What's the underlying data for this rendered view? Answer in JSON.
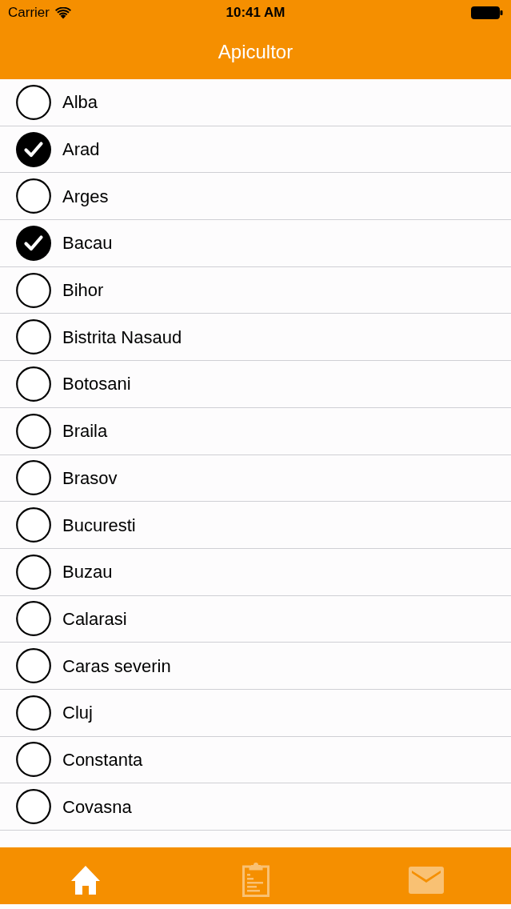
{
  "status_bar": {
    "carrier": "Carrier",
    "time": "10:41 AM"
  },
  "nav_bar": {
    "title": "Apicultor"
  },
  "list": [
    {
      "label": "Alba",
      "checked": false
    },
    {
      "label": "Arad",
      "checked": true
    },
    {
      "label": "Arges",
      "checked": false
    },
    {
      "label": "Bacau",
      "checked": true
    },
    {
      "label": "Bihor",
      "checked": false
    },
    {
      "label": "Bistrita Nasaud",
      "checked": false
    },
    {
      "label": "Botosani",
      "checked": false
    },
    {
      "label": "Braila",
      "checked": false
    },
    {
      "label": "Brasov",
      "checked": false
    },
    {
      "label": "Bucuresti",
      "checked": false
    },
    {
      "label": "Buzau",
      "checked": false
    },
    {
      "label": "Calarasi",
      "checked": false
    },
    {
      "label": "Caras severin",
      "checked": false
    },
    {
      "label": "Cluj",
      "checked": false
    },
    {
      "label": "Constanta",
      "checked": false
    },
    {
      "label": "Covasna",
      "checked": false
    }
  ],
  "tab_bar": [
    {
      "kind": "home",
      "selected": true
    },
    {
      "kind": "clipboard",
      "selected": false
    },
    {
      "kind": "mail",
      "selected": false
    }
  ]
}
